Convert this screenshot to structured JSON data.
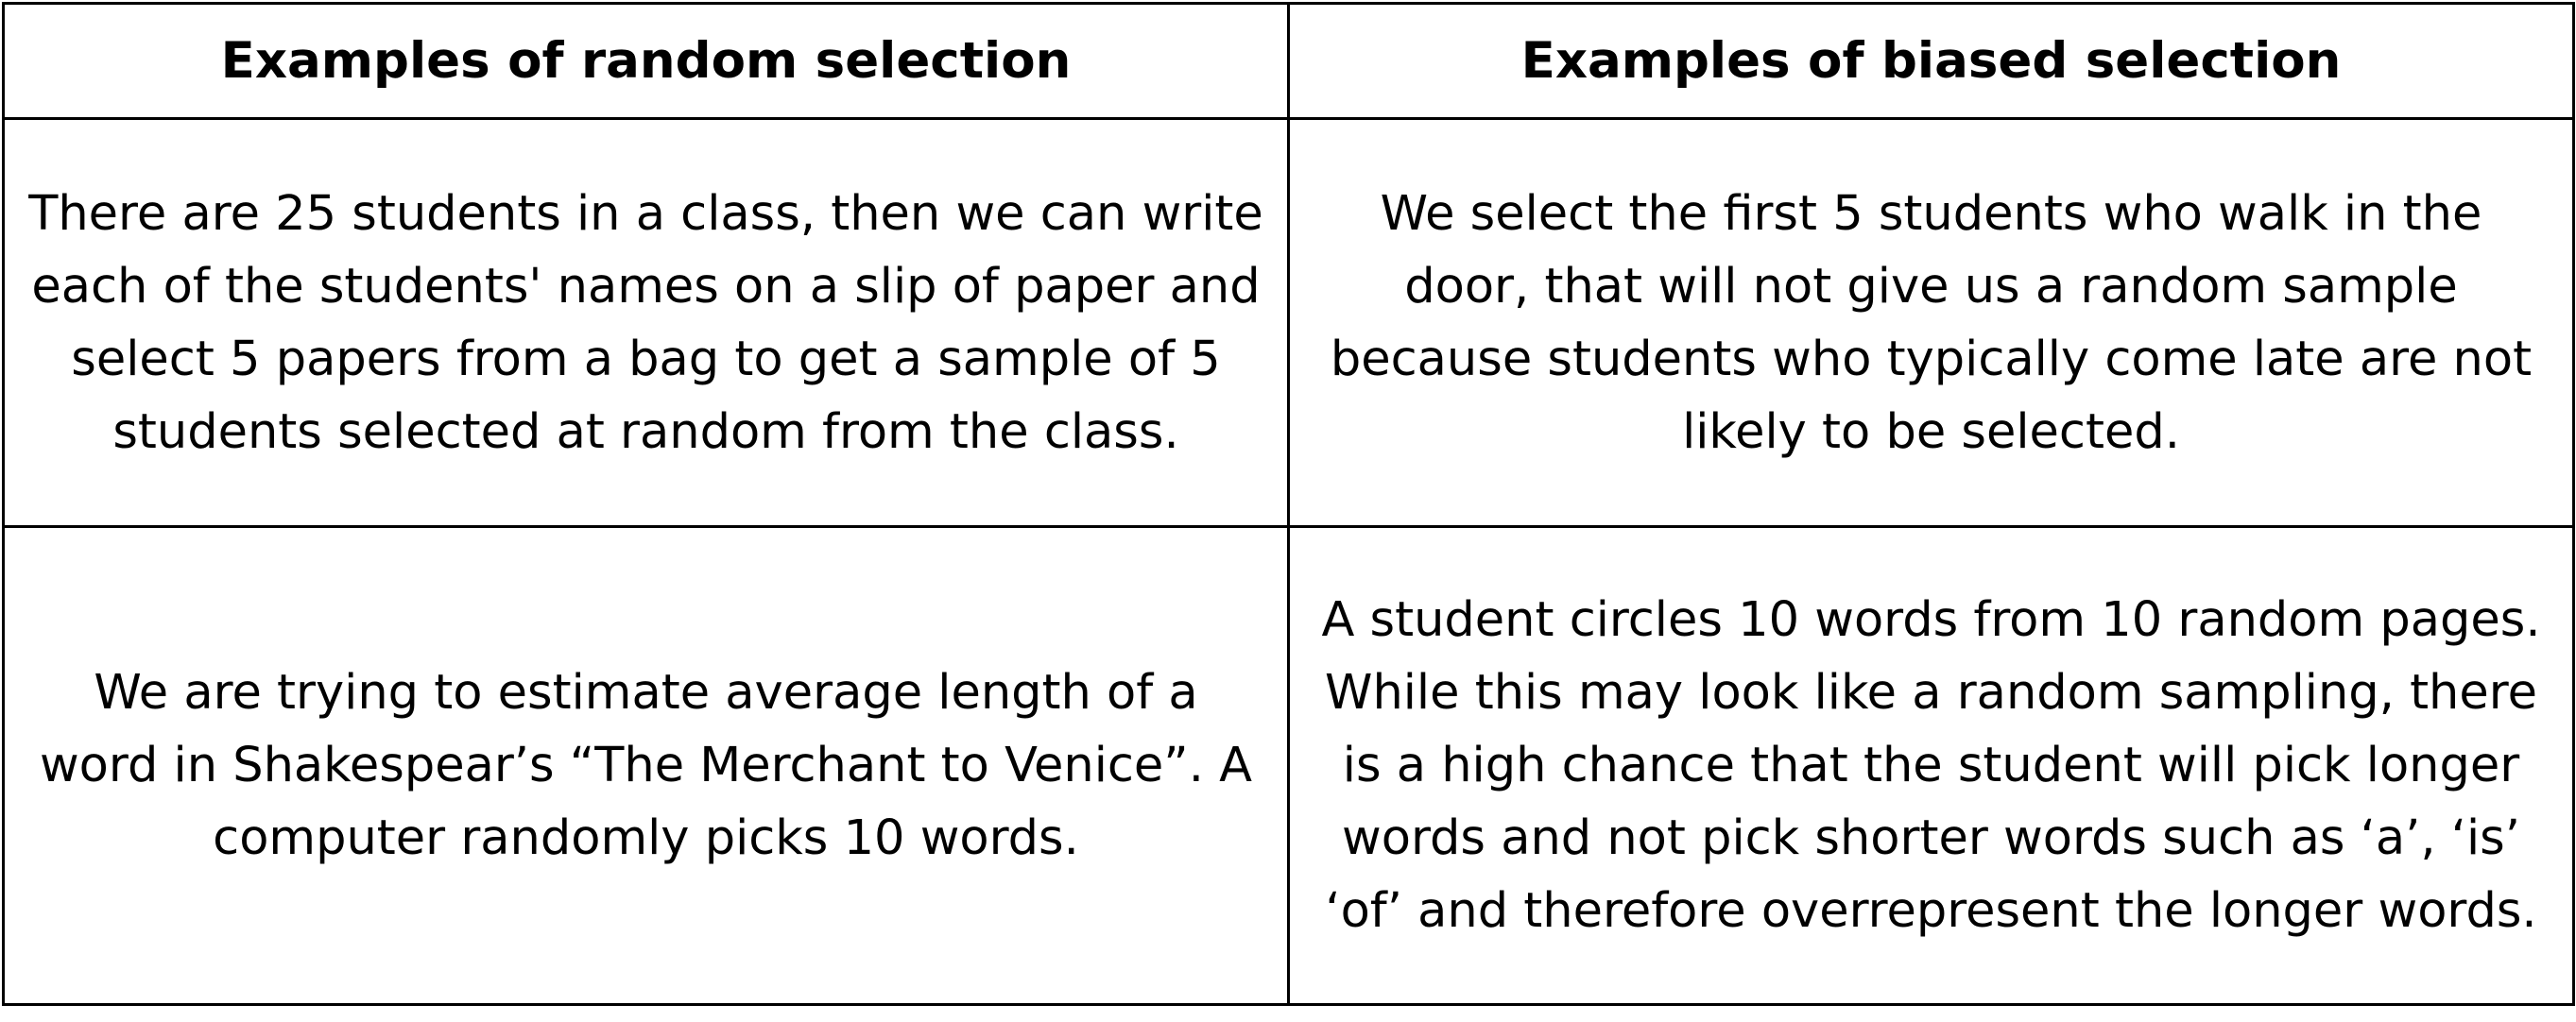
{
  "table": {
    "headers": [
      "Examples of random selection",
      "Examples of biased selection"
    ],
    "rows": [
      [
        "There are 25 students in a class, then we can write each of the students' names on a slip of paper and select 5 papers from a bag to get a sample of 5 students selected at random from the class.",
        "We select the first 5 students who walk in the door, that will not give us a random sample because students who typically come late are not likely to be selected."
      ],
      [
        "We are trying to estimate average length of a word in Shakespear’s “The Merchant to Venice”. A computer randomly picks 10 words.",
        "A student circles 10 words from 10 random pages. While this may look like a random sampling, there is a high chance that the student will pick longer words and not pick shorter words such as ‘a’, ‘is’ ‘of’ and therefore overrepresent the longer words."
      ]
    ]
  }
}
